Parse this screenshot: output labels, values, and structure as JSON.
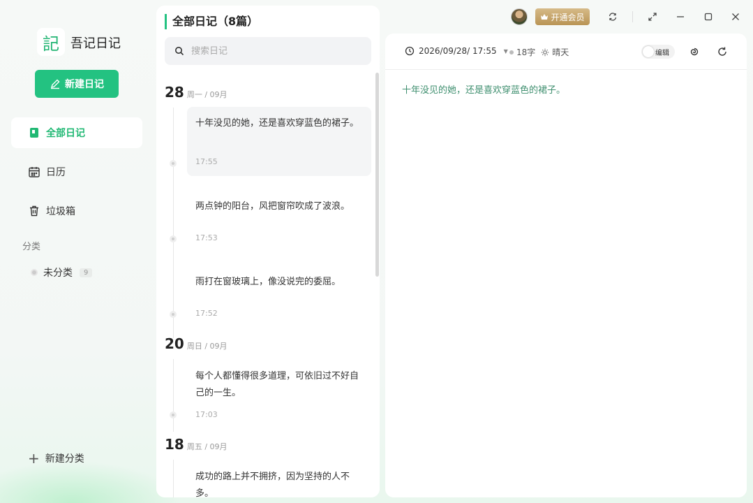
{
  "app": {
    "logo_char": "記",
    "name": "吾记日记"
  },
  "sidebar": {
    "new_diary_label": "新建日记",
    "nav": [
      {
        "label": "全部日记",
        "icon": "notebook-icon",
        "active": true
      },
      {
        "label": "日历",
        "icon": "calendar-icon",
        "active": false
      },
      {
        "label": "垃圾箱",
        "icon": "trash-icon",
        "active": false
      }
    ],
    "category_section_label": "分类",
    "categories": [
      {
        "label": "未分类",
        "count": "9"
      }
    ],
    "add_category_label": "新建分类"
  },
  "list": {
    "title": "全部日记（8篇）",
    "search_placeholder": "搜索日记",
    "groups": [
      {
        "day": "28",
        "meta": "周一 / 09月",
        "entries": [
          {
            "text": "十年没见的她，还是喜欢穿蓝色的裙子。",
            "time": "17:55",
            "selected": true
          },
          {
            "text": "两点钟的阳台，风把窗帘吹成了波浪。",
            "time": "17:53",
            "selected": false
          },
          {
            "text": "雨打在窗玻璃上，像没说完的委屈。",
            "time": "17:52",
            "selected": false
          }
        ]
      },
      {
        "day": "20",
        "meta": "周日 / 09月",
        "entries": [
          {
            "text": "每个人都懂得很多道理，可依旧过不好自己的一生。",
            "time": "17:03",
            "selected": false
          }
        ]
      },
      {
        "day": "18",
        "meta": "周五 / 09月",
        "entries": [
          {
            "text": "成功的路上并不拥挤，因为坚持的人不多。",
            "time": "",
            "selected": false
          }
        ]
      }
    ]
  },
  "window": {
    "vip_label": "开通会员",
    "controls": [
      "sync-icon",
      "fullscreen-icon",
      "minimize-icon",
      "maximize-icon",
      "close-icon"
    ]
  },
  "editor": {
    "datetime": "2026/09/28/ 17:55",
    "word_count": "18字",
    "weather": "晴天",
    "edit_toggle_label": "编辑",
    "content": "十年没见的她，还是喜欢穿蓝色的裙子。"
  },
  "colors": {
    "accent": "#23c281",
    "editor_text": "#3f8f6f",
    "vip_gold": "#c9a66b"
  }
}
